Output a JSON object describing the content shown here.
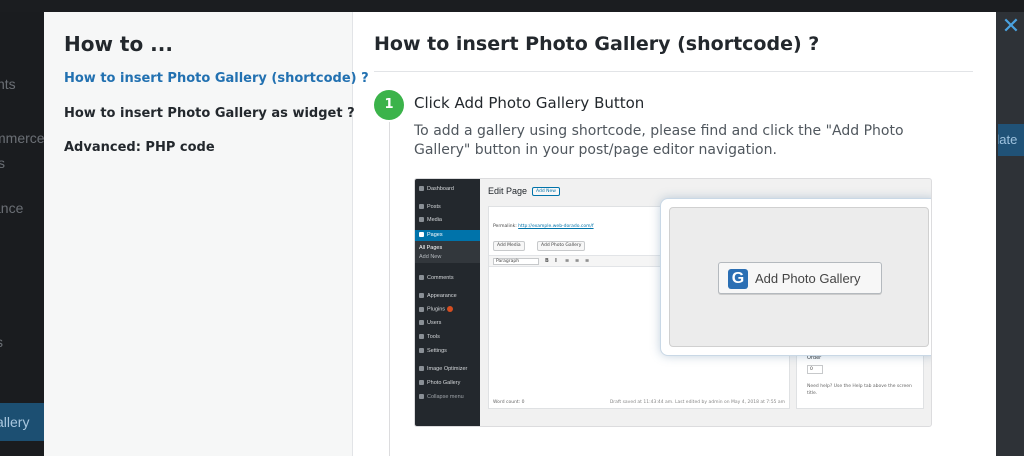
{
  "background": {
    "sidebar_fragments": [
      "nts",
      "mmerce",
      "s",
      "ance",
      "s"
    ],
    "sidebar_active": "allery",
    "right_button": "date",
    "close_symbol": "✕"
  },
  "modal": {
    "left": {
      "title": "How to ...",
      "links": [
        "How to insert Photo Gallery (shortcode) ?",
        "How to insert Photo Gallery as widget ?",
        "Advanced: PHP code"
      ],
      "active_index": 0
    },
    "right": {
      "title": "How to insert Photo Gallery (shortcode) ?",
      "step": {
        "number": "1",
        "title": "Click Add Photo Gallery Button",
        "description": "To add a gallery using shortcode, please find and click the \"Add Photo Gallery\" button in your post/page editor navigation."
      },
      "screenshot": {
        "menu": [
          "Dashboard",
          "Posts",
          "Media",
          "Pages",
          "All Pages",
          "Add New",
          "Comments",
          "Appearance",
          "Plugins",
          "Users",
          "Tools",
          "Settings",
          "Image Optimizer",
          "Photo Gallery",
          "Collapse menu"
        ],
        "page_title": "Edit Page",
        "add_new": "Add New",
        "permalink_label": "Permalink:",
        "permalink_url": "http://example.web-dorado.com/f",
        "add_media": "Add Media",
        "add_photo_gallery_small": "Add Photo Gallery",
        "paragraph": "Paragraph",
        "tools": [
          "B",
          "I",
          "≡",
          "≡",
          "≡"
        ],
        "word_count": "Word count: 0",
        "draft_saved": "Draft saved at 11:43:44 am. Last edited by admin on May 4, 2018 at 7:55 am",
        "preview": "Preview",
        "publish": "Publish",
        "order_label": "Order",
        "order_value": "0",
        "help_text": "Need help? Use the Help tab above the screen title.",
        "plugins_badge": "2",
        "big_button_label": "Add Photo Gallery",
        "big_button_icon": "G"
      }
    }
  },
  "colors": {
    "accent_link": "#2271b1",
    "step_badge": "#3bb34a",
    "wp_blue": "#0073aa"
  }
}
